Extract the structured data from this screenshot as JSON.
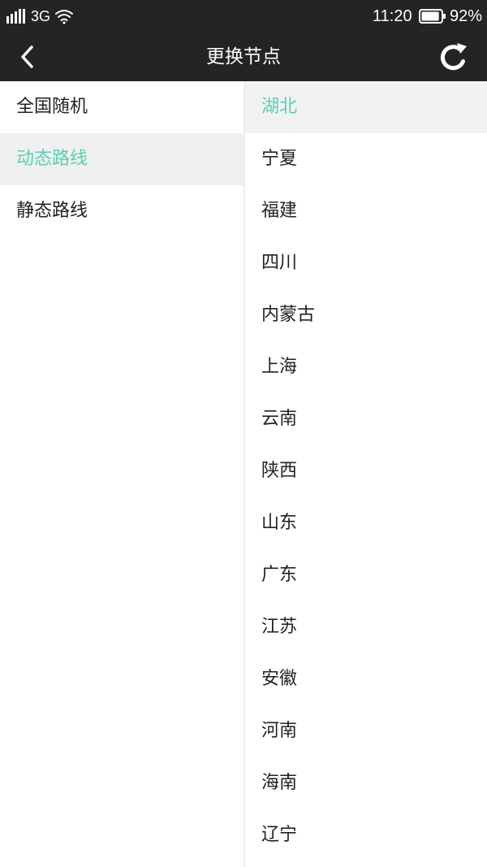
{
  "status_bar": {
    "network_type": "3G",
    "time": "11:20",
    "battery_percent": "92%",
    "battery_level": 0.92
  },
  "header": {
    "title": "更换节点",
    "back_icon": "back-chevron-icon",
    "refresh_icon": "refresh-icon"
  },
  "colors": {
    "bar_background": "#242424",
    "accent": "#5ccdb4",
    "text": "#222222"
  },
  "categories": [
    {
      "label": "全国随机",
      "selected": false
    },
    {
      "label": "动态路线",
      "selected": true
    },
    {
      "label": "静态路线",
      "selected": false
    }
  ],
  "regions": [
    {
      "label": "湖北",
      "selected": true
    },
    {
      "label": "宁夏",
      "selected": false
    },
    {
      "label": "福建",
      "selected": false
    },
    {
      "label": "四川",
      "selected": false
    },
    {
      "label": "内蒙古",
      "selected": false
    },
    {
      "label": "上海",
      "selected": false
    },
    {
      "label": "云南",
      "selected": false
    },
    {
      "label": "陕西",
      "selected": false
    },
    {
      "label": "山东",
      "selected": false
    },
    {
      "label": "广东",
      "selected": false
    },
    {
      "label": "江苏",
      "selected": false
    },
    {
      "label": "安徽",
      "selected": false
    },
    {
      "label": "河南",
      "selected": false
    },
    {
      "label": "海南",
      "selected": false
    },
    {
      "label": "辽宁",
      "selected": false
    }
  ]
}
